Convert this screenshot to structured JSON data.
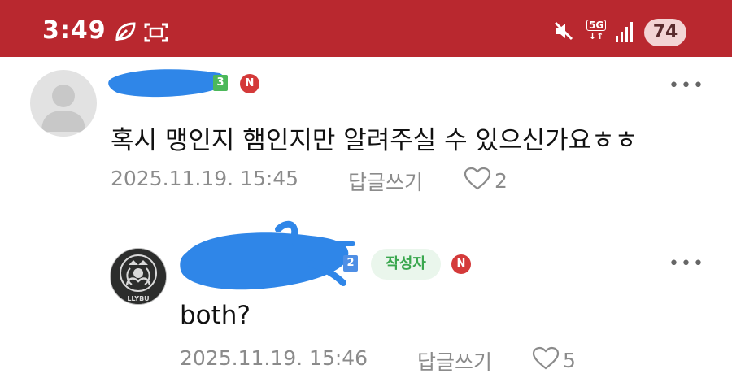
{
  "status_bar": {
    "time": "3:49",
    "network": "5G",
    "battery": "74",
    "icons": [
      "leaf-icon",
      "screen-record-icon",
      "mute-icon",
      "signal-icon"
    ]
  },
  "comments": [
    {
      "level": "3",
      "new_badge": "N",
      "text": "혹시 맹인지 햄인지만 알려주실 수 있으신가요ㅎㅎ",
      "date": "2025.11.19. 15:45",
      "reply_label": "답글쓰기",
      "likes": "2"
    },
    {
      "level": "2",
      "writer_badge": "작성자",
      "new_badge": "N",
      "text": "both?",
      "date": "2025.11.19. 15:46",
      "reply_label": "답글쓰기",
      "likes": "5"
    }
  ],
  "colors": {
    "status_bar": "#b9282f",
    "new_badge": "#d43a3a",
    "writer_badge": "#3aa74e"
  }
}
